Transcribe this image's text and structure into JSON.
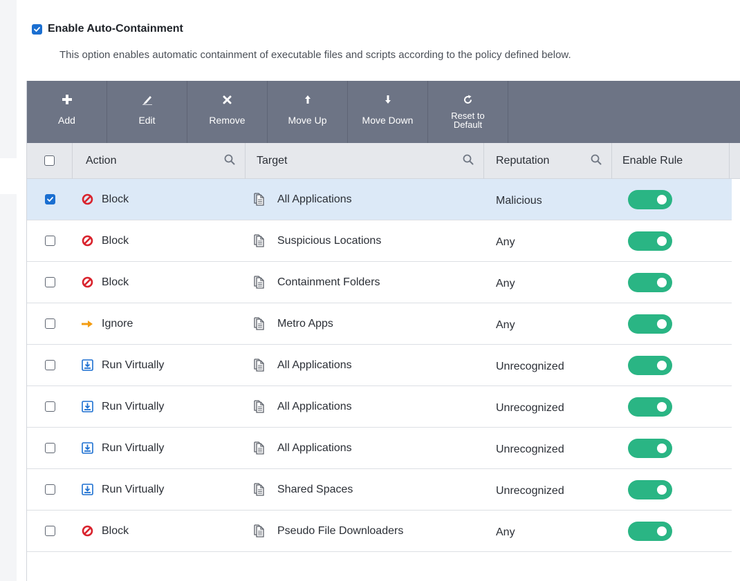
{
  "containment": {
    "enabled": true,
    "label": "Enable Auto-Containment",
    "description": "This option enables automatic containment of executable files and scripts according to the policy defined below."
  },
  "toolbar": {
    "buttons": [
      {
        "label": "Add",
        "icon": "plus-icon"
      },
      {
        "label": "Edit",
        "icon": "pencil-icon"
      },
      {
        "label": "Remove",
        "icon": "x-icon"
      },
      {
        "label": "Move Up",
        "icon": "arrow-up-icon"
      },
      {
        "label": "Move Down",
        "icon": "arrow-down-icon"
      },
      {
        "label": "Reset to Default",
        "icon": "reset-icon"
      }
    ]
  },
  "table": {
    "headers": {
      "action": "Action",
      "target": "Target",
      "reputation": "Reputation",
      "enable_rule": "Enable Rule"
    },
    "rows": [
      {
        "selected": true,
        "action": "Block",
        "action_icon": "block-icon",
        "target": "All Applications",
        "reputation": "Malicious",
        "enabled": true
      },
      {
        "selected": false,
        "action": "Block",
        "action_icon": "block-icon",
        "target": "Suspicious Locations",
        "reputation": "Any",
        "enabled": true
      },
      {
        "selected": false,
        "action": "Block",
        "action_icon": "block-icon",
        "target": "Containment Folders",
        "reputation": "Any",
        "enabled": true
      },
      {
        "selected": false,
        "action": "Ignore",
        "action_icon": "arrow-right-icon",
        "target": "Metro Apps",
        "reputation": "Any",
        "enabled": true
      },
      {
        "selected": false,
        "action": "Run Virtually",
        "action_icon": "run-virtually-icon",
        "target": "All Applications",
        "reputation": "Unrecognized",
        "enabled": true
      },
      {
        "selected": false,
        "action": "Run Virtually",
        "action_icon": "run-virtually-icon",
        "target": "All Applications",
        "reputation": "Unrecognized",
        "enabled": true
      },
      {
        "selected": false,
        "action": "Run Virtually",
        "action_icon": "run-virtually-icon",
        "target": "All Applications",
        "reputation": "Unrecognized",
        "enabled": true
      },
      {
        "selected": false,
        "action": "Run Virtually",
        "action_icon": "run-virtually-icon",
        "target": "Shared Spaces",
        "reputation": "Unrecognized",
        "enabled": true
      },
      {
        "selected": false,
        "action": "Block",
        "action_icon": "block-icon",
        "target": "Pseudo File Downloaders",
        "reputation": "Any",
        "enabled": true
      }
    ]
  },
  "colors": {
    "accent": "#1b6fd1",
    "toolbar_bg": "#6d7485",
    "toggle_on": "#2ab584",
    "block_red": "#d9232d",
    "ignore_orange": "#f39c12",
    "selected_row": "#dce9f7"
  }
}
